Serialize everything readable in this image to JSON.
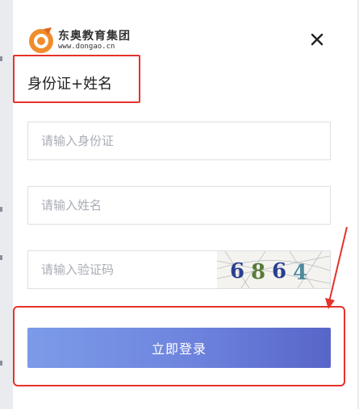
{
  "brand": {
    "name": "东奥教育集团",
    "url": "www.dongao.cn",
    "logo_icon": "dongao-logo-icon"
  },
  "dialog": {
    "title": "身份证+姓名",
    "close_icon": "close-icon"
  },
  "form": {
    "id_placeholder": "请输入身份证",
    "name_placeholder": "请输入姓名",
    "captcha_placeholder": "请输入验证码",
    "captcha_text": "6864",
    "captcha_digit_colors": [
      "#2a3f8f",
      "#5a7a3a",
      "#2a3f8f",
      "#4f8a9e"
    ],
    "submit_label": "立即登录"
  },
  "colors": {
    "highlight": "#e5332a",
    "button_start": "#7b9be8",
    "button_end": "#5865c8",
    "logo_orange": "#f08c2b"
  }
}
